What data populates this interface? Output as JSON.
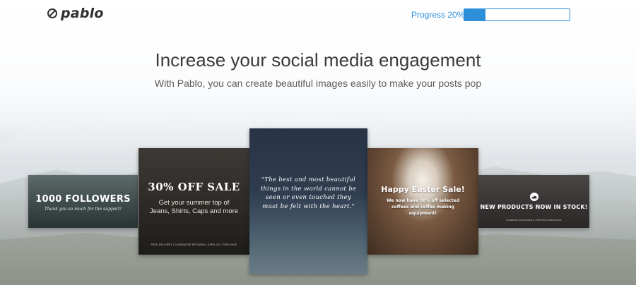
{
  "header": {
    "logo_text": "pablo",
    "logo_icon": "check-circle-icon",
    "progress_label": "Progress 20%",
    "progress_fraction": 0.2,
    "accent_color": "#2d8fd8"
  },
  "hero": {
    "title": "Increase your social media engagement",
    "subtitle": "With Pablo, you can create beautiful images easily to make your posts pop"
  },
  "cards": [
    {
      "title": "1000 FOLLOWERS",
      "subtitle": "Thank you so much for the support!"
    },
    {
      "title": "30% OFF SALE",
      "subtitle": "Get your summer top of Jeans, Shirts, Caps and more",
      "footer": "FREE DELIVERY | GUARANTEE RETURNS | OPEN 24/7 PURCHASE"
    },
    {
      "quote": "\"The best and most beautiful things in the world cannot be seen or even touched they must be felt with the heart.\""
    },
    {
      "title": "Happy Easter Sale!",
      "subtitle": "We now have 50% off selected coffees and coffee making equipment!"
    },
    {
      "title": "NEW PRODUCTS NOW IN STOCK!",
      "icon": "cloud-icon",
      "footer": "FACEBOOK.COM/EXAMPLE | TWITTER.COM/EXAMPLE"
    }
  ]
}
